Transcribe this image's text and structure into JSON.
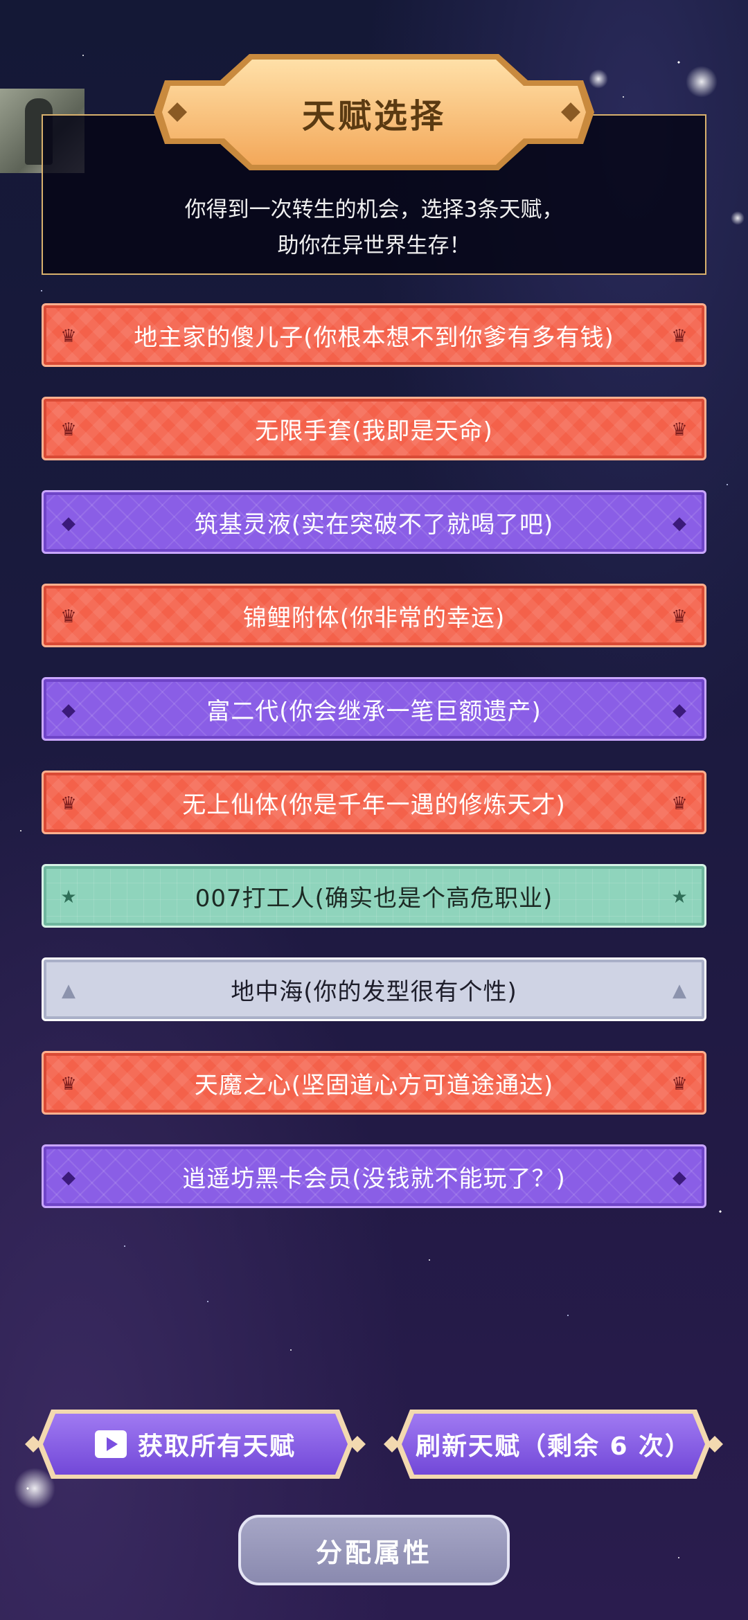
{
  "header": {
    "title": "天赋选择",
    "description_line1": "你得到一次转生的机会，选择3条天赋，",
    "description_line2": "助你在异世界生存！"
  },
  "talents": [
    {
      "label": "地主家的傻儿子(你根本想不到你爹有多有钱)",
      "tier": "orange",
      "icon": "crown-icon"
    },
    {
      "label": "无限手套(我即是天命)",
      "tier": "orange",
      "icon": "crown-icon"
    },
    {
      "label": "筑基灵液(实在突破不了就喝了吧)",
      "tier": "purple",
      "icon": "diamond-icon"
    },
    {
      "label": "锦鲤附体(你非常的幸运)",
      "tier": "orange",
      "icon": "crown-icon"
    },
    {
      "label": "富二代(你会继承一笔巨额遗产)",
      "tier": "purple",
      "icon": "diamond-icon"
    },
    {
      "label": "无上仙体(你是千年一遇的修炼天才)",
      "tier": "orange",
      "icon": "crown-icon"
    },
    {
      "label": "007打工人(确实也是个高危职业)",
      "tier": "green",
      "icon": "star-icon"
    },
    {
      "label": "地中海(你的发型很有个性)",
      "tier": "gray",
      "icon": "triangle-icon"
    },
    {
      "label": "天魔之心(坚固道心方可道途通达)",
      "tier": "orange",
      "icon": "crown-icon"
    },
    {
      "label": "逍遥坊黑卡会员(没钱就不能玩了？)",
      "tier": "purple",
      "icon": "diamond-icon"
    }
  ],
  "actions": {
    "get_all_label": "获取所有天赋",
    "refresh_label": "刷新天赋（剩余 6 次）",
    "assign_label": "分配属性"
  },
  "colors": {
    "orange_tier": "#f4614a",
    "purple_tier": "#8a5ee6",
    "green_tier": "#8fd4bc",
    "gray_tier": "#cfd3e4",
    "title_plate": "#fcc57e",
    "button_purple": "#8a5ee6"
  }
}
